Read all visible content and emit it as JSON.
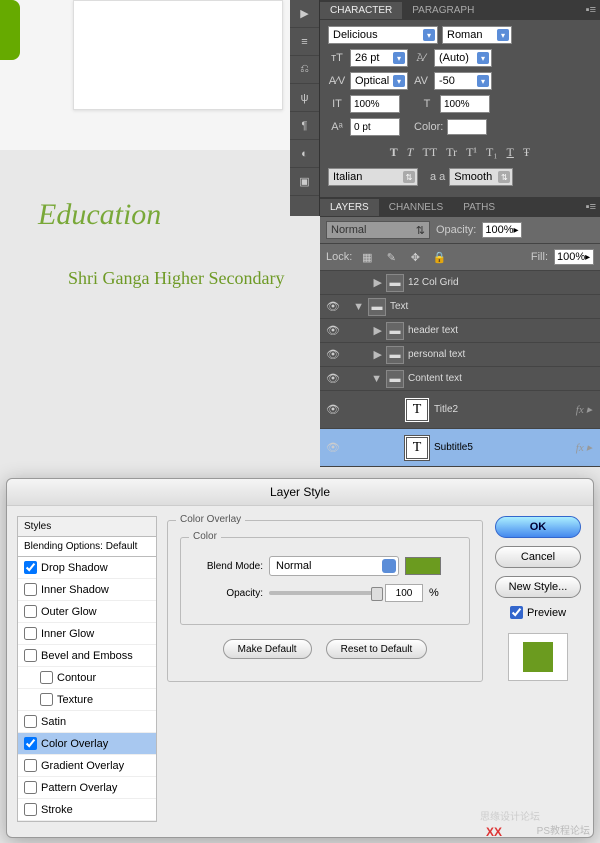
{
  "canvas": {
    "heading": "Education",
    "subheading": "Shri Ganga Higher Secondary"
  },
  "char": {
    "tabs": [
      "CHARACTER",
      "PARAGRAPH"
    ],
    "font": "Delicious",
    "style": "Roman",
    "size": "26 pt",
    "leading": "(Auto)",
    "kerning": "Optical",
    "tracking": "-50",
    "vscale": "100%",
    "hscale": "100%",
    "baseline": "0 pt",
    "colorLabel": "Color:",
    "lang": "Italian",
    "aaLabel": "a a",
    "aa": "Smooth",
    "typeBtns": [
      "T",
      "T",
      "TT",
      "Tr",
      "T¹",
      "T₁",
      "T",
      "Ŧ"
    ]
  },
  "layers": {
    "tabs": [
      "LAYERS",
      "CHANNELS",
      "PATHS"
    ],
    "blend": "Normal",
    "opacityLabel": "Opacity:",
    "opacity": "100%",
    "lockLabel": "Lock:",
    "fillLabel": "Fill:",
    "fill": "100%",
    "items": [
      {
        "name": "12 Col Grid",
        "indent": 1,
        "fold": "▶",
        "eye": false,
        "type": "folder"
      },
      {
        "name": "Text",
        "indent": 0,
        "fold": "▼",
        "eye": true,
        "type": "folder"
      },
      {
        "name": "header text",
        "indent": 1,
        "fold": "▶",
        "eye": true,
        "type": "folder"
      },
      {
        "name": "personal text",
        "indent": 1,
        "fold": "▶",
        "eye": true,
        "type": "folder"
      },
      {
        "name": "Content text",
        "indent": 1,
        "fold": "▼",
        "eye": true,
        "type": "folder"
      },
      {
        "name": "Title2",
        "indent": 2,
        "eye": true,
        "type": "text",
        "fx": true
      },
      {
        "name": "Subtitle5",
        "indent": 2,
        "eye": true,
        "type": "text",
        "fx": true,
        "selected": true
      }
    ]
  },
  "dialog": {
    "title": "Layer Style",
    "stylesHdr": "Styles",
    "blendDefault": "Blending Options: Default",
    "effects": [
      {
        "label": "Drop Shadow",
        "checked": true
      },
      {
        "label": "Inner Shadow",
        "checked": false
      },
      {
        "label": "Outer Glow",
        "checked": false
      },
      {
        "label": "Inner Glow",
        "checked": false
      },
      {
        "label": "Bevel and Emboss",
        "checked": false
      },
      {
        "label": "Contour",
        "checked": false,
        "indent": true
      },
      {
        "label": "Texture",
        "checked": false,
        "indent": true
      },
      {
        "label": "Satin",
        "checked": false
      },
      {
        "label": "Color Overlay",
        "checked": true,
        "selected": true
      },
      {
        "label": "Gradient Overlay",
        "checked": false
      },
      {
        "label": "Pattern Overlay",
        "checked": false
      },
      {
        "label": "Stroke",
        "checked": false
      }
    ],
    "section": "Color Overlay",
    "subsection": "Color",
    "blendLabel": "Blend Mode:",
    "blendMode": "Normal",
    "opacityLabel": "Opacity:",
    "opacity": "100",
    "opacityUnit": "%",
    "makeDefault": "Make Default",
    "resetDefault": "Reset to Default",
    "ok": "OK",
    "cancel": "Cancel",
    "newStyle": "New Style...",
    "preview": "Preview",
    "overlayColor": "#6b9b1f"
  },
  "watermark": {
    "a": "思缘设计论坛",
    "b": "PS教程论坛",
    "x": "XX"
  }
}
